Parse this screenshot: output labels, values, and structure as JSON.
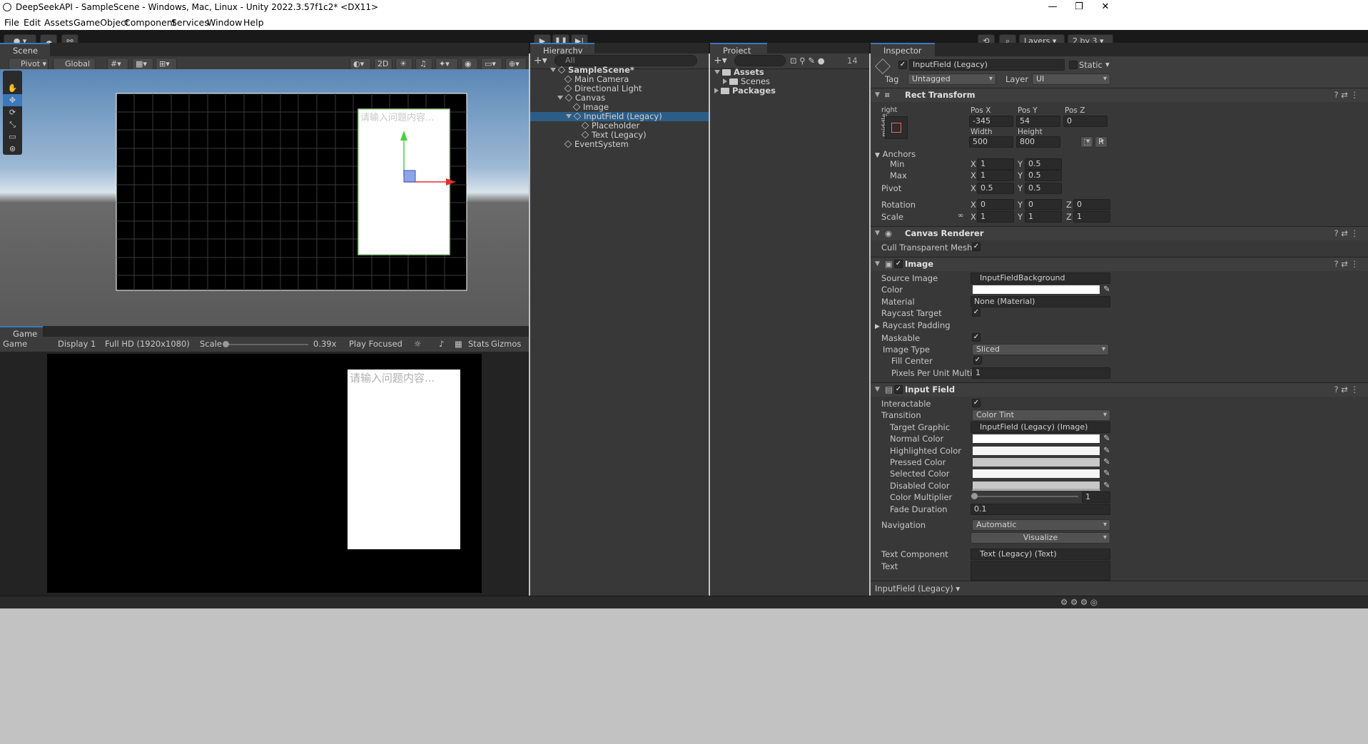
{
  "window": {
    "title": "DeepSeekAPI - SampleScene - Windows, Mac, Linux - Unity 2022.3.57f1c2* <DX11>",
    "minimize": "—",
    "maximize": "❐",
    "close": "✕"
  },
  "menu": [
    "File",
    "Edit",
    "Assets",
    "GameObject",
    "Component",
    "Services",
    "Window",
    "Help"
  ],
  "toolbar": {
    "layers": "Layers",
    "layout": "2 by 3"
  },
  "scene": {
    "tab": "Scene",
    "pivot": "Pivot",
    "global": "Global",
    "btn2d": "2D",
    "placeholder": "请输入问题内容..."
  },
  "game": {
    "tab": "Game",
    "mode": "Game",
    "display": "Display 1",
    "resolution": "Full HD (1920x1080)",
    "scale_label": "Scale",
    "scale_value": "0.39x",
    "play_focused": "Play Focused",
    "stats": "Stats",
    "gizmos": "Gizmos",
    "placeholder": "请输入问题内容..."
  },
  "hierarchy": {
    "tab": "Hierarchy",
    "search_placeholder": "All",
    "items": [
      {
        "label": "SampleScene*",
        "depth": 0,
        "bold": true,
        "arrow": "down"
      },
      {
        "label": "Main Camera",
        "depth": 1
      },
      {
        "label": "Directional Light",
        "depth": 1
      },
      {
        "label": "Canvas",
        "depth": 1,
        "arrow": "down"
      },
      {
        "label": "Image",
        "depth": 2
      },
      {
        "label": "InputField (Legacy)",
        "depth": 2,
        "arrow": "down",
        "selected": true
      },
      {
        "label": "Placeholder",
        "depth": 3
      },
      {
        "label": "Text (Legacy)",
        "depth": 3
      },
      {
        "label": "EventSystem",
        "depth": 1
      }
    ]
  },
  "project": {
    "tab": "Project",
    "count": "14",
    "items": [
      {
        "label": "Assets",
        "depth": 0,
        "bold": true,
        "arrow": "down"
      },
      {
        "label": "Scenes",
        "depth": 1,
        "arrow": "right"
      },
      {
        "label": "Packages",
        "depth": 0,
        "bold": true,
        "arrow": "right"
      }
    ]
  },
  "inspector": {
    "tab": "Inspector",
    "object_name": "InputField (Legacy)",
    "static_label": "Static",
    "tag_label": "Tag",
    "tag_value": "Untagged",
    "layer_label": "Layer",
    "layer_value": "UI",
    "rect": {
      "title": "Rect Transform",
      "anchor_h": "right",
      "anchor_v": "middle",
      "posx_label": "Pos X",
      "posy_label": "Pos Y",
      "posz_label": "Pos Z",
      "posx": "-345",
      "posy": "54",
      "posz": "0",
      "width_label": "Width",
      "height_label": "Height",
      "width": "500",
      "height": "800",
      "blueprint": "⬚",
      "raw": "R",
      "anchors_label": "Anchors",
      "min_label": "Min",
      "max_label": "Max",
      "pivot_label": "Pivot",
      "rotation_label": "Rotation",
      "scale_label": "Scale",
      "min_x": "1",
      "min_y": "0.5",
      "max_x": "1",
      "max_y": "0.5",
      "pivot_x": "0.5",
      "pivot_y": "0.5",
      "rot_x": "0",
      "rot_y": "0",
      "rot_z": "0",
      "scale_x": "1",
      "scale_y": "1",
      "scale_z": "1"
    },
    "canvas_renderer": {
      "title": "Canvas Renderer",
      "cull_label": "Cull Transparent Mesh"
    },
    "image": {
      "title": "Image",
      "source_label": "Source Image",
      "source_value": "InputFieldBackground",
      "color_label": "Color",
      "material_label": "Material",
      "material_value": "None (Material)",
      "raycast_label": "Raycast Target",
      "raycast_padding_label": "Raycast Padding",
      "maskable_label": "Maskable",
      "image_type_label": "Image Type",
      "image_type_value": "Sliced",
      "fill_center_label": "Fill Center",
      "ppu_label": "Pixels Per Unit Multiplier",
      "ppu_value": "1"
    },
    "input_field": {
      "title": "Input Field",
      "interactable_label": "Interactable",
      "transition_label": "Transition",
      "transition_value": "Color Tint",
      "target_label": "Target Graphic",
      "target_value": "InputField (Legacy) (Image)",
      "normal_label": "Normal Color",
      "highlighted_label": "Highlighted Color",
      "pressed_label": "Pressed Color",
      "selected_label": "Selected Color",
      "disabled_label": "Disabled Color",
      "multiplier_label": "Color Multiplier",
      "multiplier_value": "1",
      "fade_label": "Fade Duration",
      "fade_value": "0.1",
      "navigation_label": "Navigation",
      "navigation_value": "Automatic",
      "visualize_label": "Visualize",
      "text_component_label": "Text Component",
      "text_component_value": "Text (Legacy) (Text)",
      "text_label": "Text"
    },
    "footer": "InputField (Legacy)"
  },
  "colors": {
    "accent": "#2c5d87",
    "selected_row": "#2c5d87",
    "tab_highlight": "#3a79bb"
  }
}
